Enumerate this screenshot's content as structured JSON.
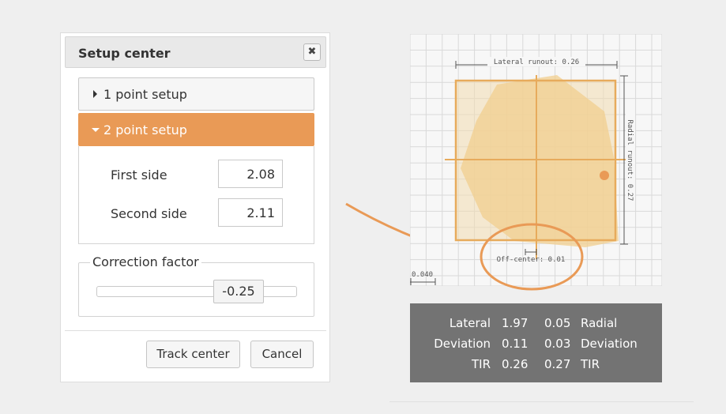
{
  "dialog": {
    "title": "Setup center",
    "close_glyph": "✖",
    "accordion": [
      {
        "label": "1 point setup",
        "expanded": false
      },
      {
        "label": "2 point setup",
        "expanded": true
      }
    ],
    "fields": {
      "first_side": {
        "label": "First side",
        "value": "2.08"
      },
      "second_side": {
        "label": "Second side",
        "value": "2.11"
      }
    },
    "correction": {
      "legend": "Correction factor",
      "value": "-0.25"
    },
    "buttons": {
      "track": "Track center",
      "cancel": "Cancel"
    }
  },
  "plot": {
    "lateral_runout": "Lateral runout: 0.26",
    "radial_runout": "Radial runout: 0.27",
    "off_center": "Off-center: 0.01",
    "scale": "0.040",
    "accent_color": "#e99a56",
    "fill_color": "#f2cf8f"
  },
  "stats": {
    "rows": [
      {
        "left_label": "Lateral",
        "v1": "1.97",
        "v2": "0.05",
        "right_label": "Radial"
      },
      {
        "left_label": "Deviation",
        "v1": "0.11",
        "v2": "0.03",
        "right_label": "Deviation"
      },
      {
        "left_label": "TIR",
        "v1": "0.26",
        "v2": "0.27",
        "right_label": "TIR"
      }
    ]
  }
}
